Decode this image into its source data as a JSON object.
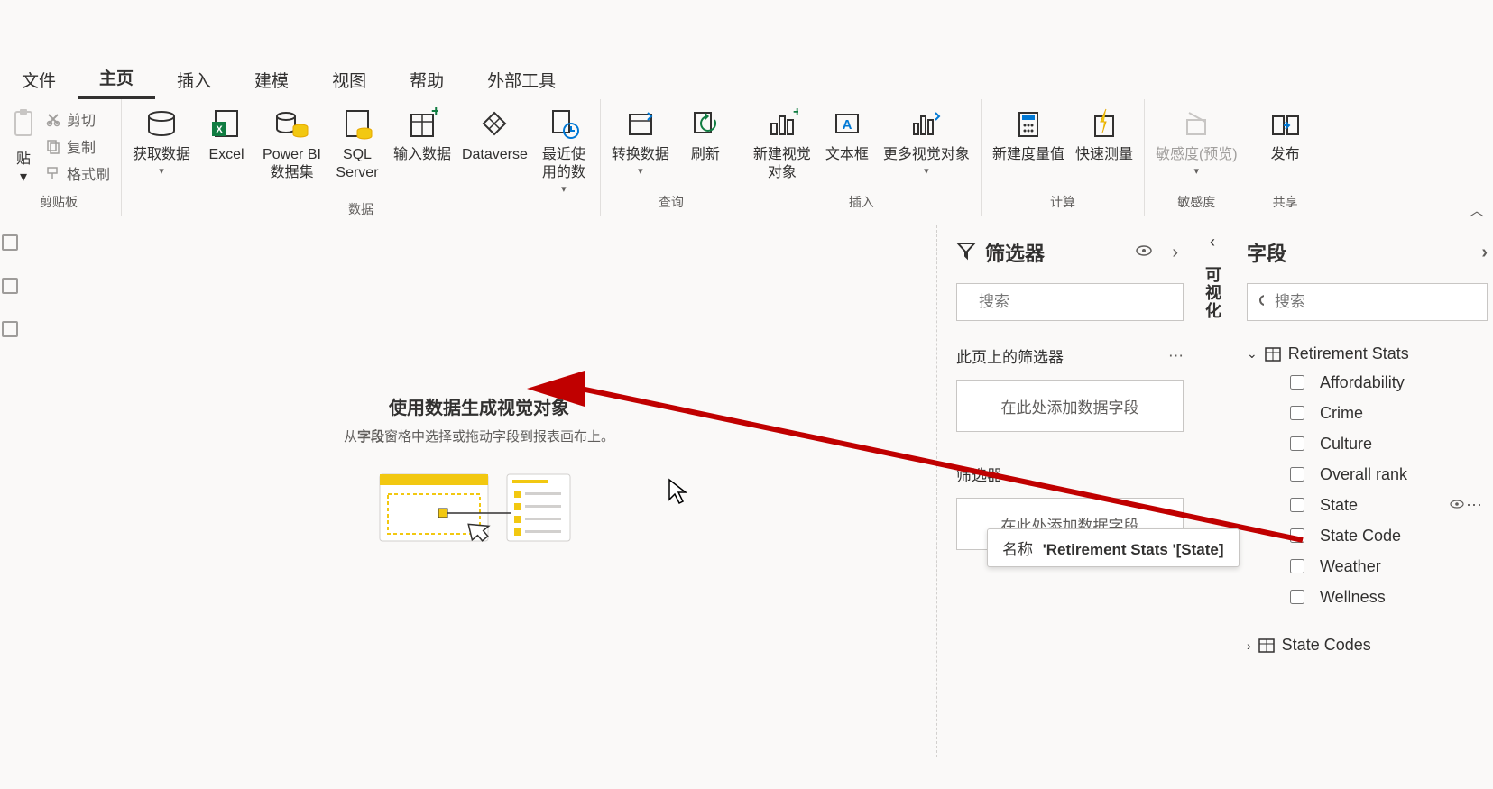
{
  "menu": {
    "tabs": [
      "文件",
      "主页",
      "插入",
      "建模",
      "视图",
      "帮助",
      "外部工具"
    ],
    "active_index": 1
  },
  "ribbon": {
    "clipboard": {
      "paste": "贴",
      "cut": "剪切",
      "copy": "复制",
      "format_painter": "格式刷",
      "group_title": "剪贴板"
    },
    "data": {
      "get_data": "获取数据",
      "excel": "Excel",
      "powerbi_dataset": "Power BI\n数据集",
      "sql_server": "SQL\nServer",
      "enter_data": "输入数据",
      "dataverse": "Dataverse",
      "recent": "最近使\n用的数",
      "group_title": "数据"
    },
    "queries": {
      "transform": "转换数据",
      "refresh": "刷新",
      "group_title": "查询"
    },
    "insert": {
      "new_visual": "新建视觉\n对象",
      "textbox": "文本框",
      "more_visuals": "更多视觉对象",
      "group_title": "插入"
    },
    "calculations": {
      "new_measure": "新建度量值",
      "quick_measure": "快速测量",
      "group_title": "计算"
    },
    "sensitivity": {
      "label": "敏感度(预览)",
      "group_title": "敏感度"
    },
    "share": {
      "publish": "发布",
      "group_title": "共享"
    }
  },
  "canvas": {
    "title": "使用数据生成视觉对象",
    "subtitle_pre": "从",
    "subtitle_bold": "字段",
    "subtitle_post": "窗格中选择或拖动字段到报表画布上。"
  },
  "filters": {
    "title": "筛选器",
    "search_placeholder": "搜索",
    "page_filters_title": "此页上的筛选器",
    "dropzone_text": "在此处添加数据字段",
    "all_filters_title": "筛选器"
  },
  "viz": {
    "title": "可视化"
  },
  "fields": {
    "title": "字段",
    "search_placeholder": "搜索",
    "tables": [
      {
        "name": "Retirement Stats",
        "expanded": true,
        "columns": [
          "Affordability",
          "Crime",
          "Culture",
          "Overall rank",
          "State",
          "State Code",
          "Weather",
          "Wellness"
        ],
        "hover_index": 4
      },
      {
        "name": "State Codes",
        "expanded": false
      }
    ]
  },
  "tooltip": {
    "label": "名称",
    "value": "'Retirement Stats '[State]"
  }
}
